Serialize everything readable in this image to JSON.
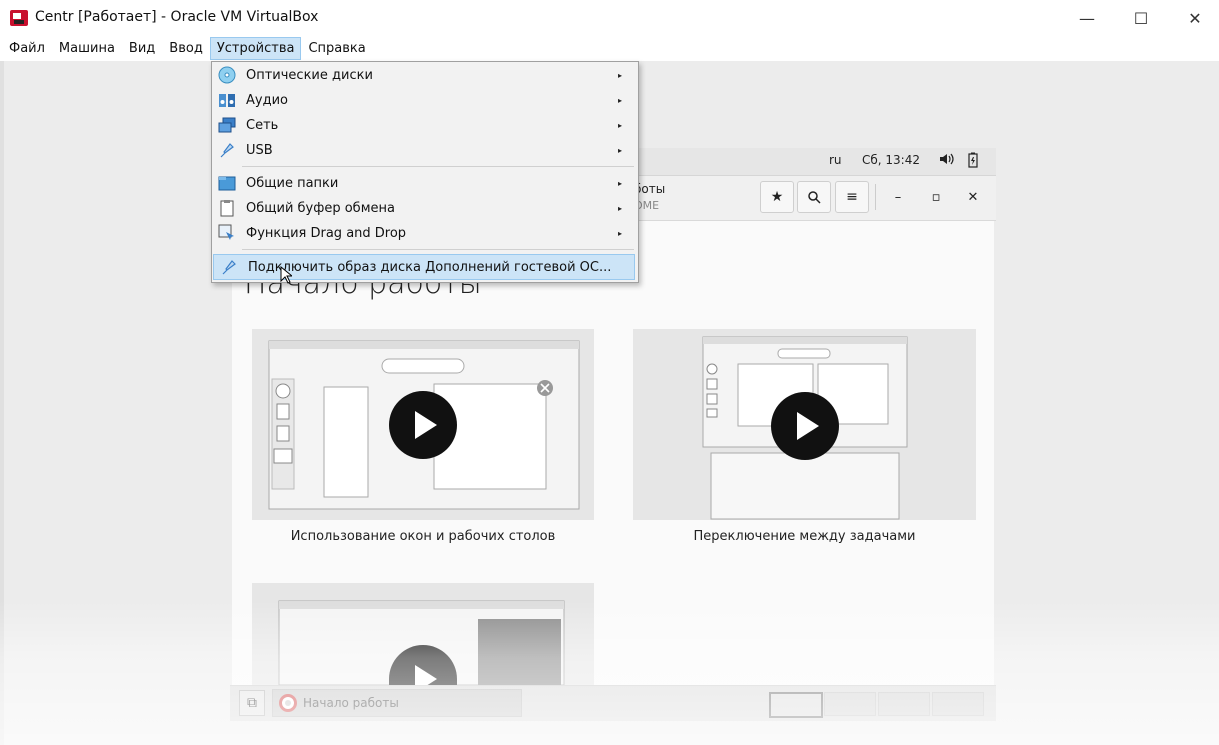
{
  "window": {
    "title": "Centr [Работает] - Oracle VM VirtualBox",
    "minimize_glyph": "—",
    "maximize_glyph": "☐",
    "close_glyph": "✕"
  },
  "menubar": {
    "items": [
      {
        "label": "Файл"
      },
      {
        "label": "Машина"
      },
      {
        "label": "Вид"
      },
      {
        "label": "Ввод"
      },
      {
        "label": "Устройства",
        "active": true
      },
      {
        "label": "Справка"
      }
    ]
  },
  "devices_menu": {
    "items": [
      {
        "label": "Оптические диски",
        "icon": "optical-disc-icon",
        "submenu": true
      },
      {
        "label": "Аудио",
        "icon": "audio-icon",
        "submenu": true
      },
      {
        "label": "Сеть",
        "icon": "network-icon",
        "submenu": true
      },
      {
        "label": "USB",
        "icon": "usb-icon",
        "submenu": true
      },
      {
        "label": "Общие папки",
        "icon": "shared-folder-icon",
        "submenu": true
      },
      {
        "label": "Общий буфер обмена",
        "icon": "clipboard-icon",
        "submenu": true
      },
      {
        "label": "Функция Drag and Drop",
        "icon": "drag-drop-icon",
        "submenu": true
      },
      {
        "label": "Подключить образ диска Дополнений гостевой ОС...",
        "icon": "guest-additions-icon",
        "submenu": false,
        "highlighted": true
      }
    ],
    "submenu_arrow": "▸"
  },
  "guest": {
    "topbar": {
      "lang": "ru",
      "clock": "Сб, 13:42",
      "volume_glyph": "🔈",
      "battery_glyph": "🔋"
    },
    "headerbar": {
      "title": "боты",
      "subtitle": "ОМЕ",
      "star_glyph": "★",
      "search_glyph": "🔍",
      "menu_glyph": "≡",
      "min_glyph": "–",
      "max_glyph": "▫",
      "close_glyph": "✕"
    },
    "page_title": "Начало работы",
    "tiles": [
      {
        "caption": "Использование окон и рабочих столов"
      },
      {
        "caption": "Переключение между задачами"
      },
      {
        "caption": ""
      }
    ],
    "taskbar": {
      "show_desktop_glyph": "⧉",
      "app_label": "Начало работы",
      "workspaces": 4
    }
  },
  "colors": {
    "menu_highlight": "#cce4f7",
    "menu_highlight_border": "#99c9ef",
    "play_button": "#111111"
  }
}
